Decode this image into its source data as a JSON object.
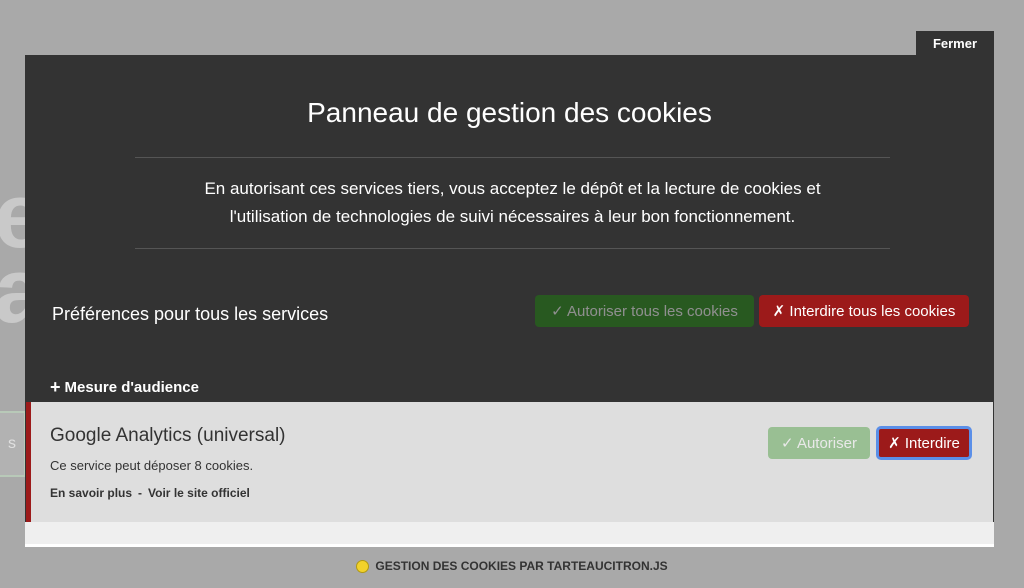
{
  "close_button": "Fermer",
  "panel": {
    "title": "Panneau de gestion des cookies",
    "intro_line1": "En autorisant ces services tiers, vous acceptez le dépôt et la lecture de cookies et",
    "intro_line2": "l'utilisation de technologies de suivi nécessaires à leur bon fonctionnement.",
    "prefs_label": "Préférences pour tous les services",
    "allow_all_label": "✓ Autoriser tous les cookies",
    "deny_all_label": "✗ Interdire tous les cookies"
  },
  "section": {
    "icon": "plus-icon",
    "title": "Mesure d'audience"
  },
  "service": {
    "name": "Google Analytics (universal)",
    "description": "Ce service peut déposer 8 cookies.",
    "learn_more": "En savoir plus",
    "separator": "-",
    "official_site": "Voir le site officiel",
    "allow_label": "✓ Autoriser",
    "deny_label": "✗ Interdire",
    "state": "denied"
  },
  "footer": {
    "icon": "lemon-icon",
    "text": "GESTION DES COOKIES PAR TARTEAUCITRON.JS"
  },
  "background": {
    "glyph1": "e",
    "glyph2": "a",
    "tab_text": "s"
  },
  "colors": {
    "panel_bg": "#333333",
    "allow_green": "#1b870b",
    "deny_red": "#9c1a1a",
    "focus_blue": "#5b8fe8",
    "service_bg": "#dedede"
  }
}
